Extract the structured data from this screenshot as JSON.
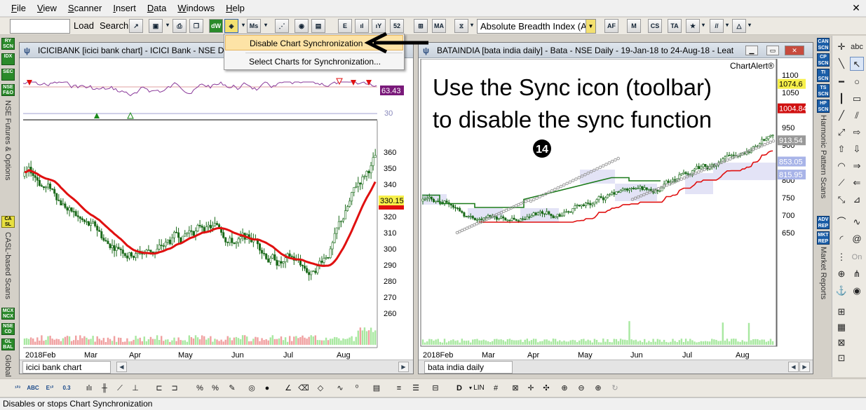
{
  "menu": [
    "File",
    "View",
    "Scanner",
    "Insert",
    "Data",
    "Windows",
    "Help"
  ],
  "menu_underline": [
    "F",
    "V",
    "S",
    "I",
    "D",
    "W",
    "H"
  ],
  "toolbar": {
    "load_label": "Load",
    "search_label": "Search",
    "indicator_combo": "Absolute Breadth Index (ABI",
    "icons": [
      "sync-icon",
      "save-icon",
      "print-icon",
      "dw-icon",
      "chart-sync-icon",
      "ms-icon",
      "grid-icon",
      "gauge-icon",
      "indicator-icon",
      "52w-icon",
      "ma-icon",
      "harmonic-icon",
      "autofib-icon",
      "mpvt-icon",
      "cswtam-icon",
      "tas-icon",
      "trend-icon",
      "pattern-icon"
    ]
  },
  "sync_menu": {
    "disable": "Disable Chart Synchronization",
    "select": "Select Charts for Synchronization..."
  },
  "left_sidebar": {
    "buttons": [
      "RY SCN",
      "IDX",
      "SEC",
      "NSE F&O",
      "CA SL",
      "MCX NCX",
      "NSE CD",
      "GL BAL"
    ],
    "labels": [
      "NSE Futures & Options",
      "CASL-based Scans",
      "Global I"
    ]
  },
  "chart_left": {
    "title": "ICICIBANK [icici bank chart] - ICICI Bank - NSE Dai",
    "tab": "icici bank chart",
    "indicator_value": "63.43",
    "indicator_low": "30",
    "price_labels": [
      "360",
      "350",
      "340",
      "330",
      "320",
      "310",
      "300",
      "290",
      "280",
      "270",
      "260"
    ],
    "last_price": "330.15",
    "months": [
      "2018Feb",
      "Mar",
      "Apr",
      "May",
      "Jun",
      "Jul",
      "Aug"
    ]
  },
  "chart_right": {
    "title": "BATAINDIA [bata india daily] - Bata - NSE Daily - 19-Jan-18 to 24-Aug-18 - Leat",
    "tab": "bata india daily",
    "watermark": "ChartAlert®",
    "annotation_line1": "Use the Sync icon (toolbar)",
    "annotation_line2": "to disable the sync function",
    "step_badge": "14",
    "price_labels": [
      "1100",
      "1050",
      "950",
      "900",
      "800",
      "750",
      "700",
      "650"
    ],
    "tag_last": "1074.6",
    "tag_stop": "1004.84",
    "tag_psar": "913.54",
    "tag_band_top": "853.05",
    "tag_band_bottom": "815.95",
    "months": [
      "2018Feb",
      "Mar",
      "Apr",
      "May",
      "Jun",
      "Jul",
      "Aug"
    ]
  },
  "right_sidebar": {
    "buttons": [
      "CAN SCN",
      "CP SCN",
      "TI SCN",
      "TS SCN",
      "HP SCN",
      "ADV REP",
      "MKT REP"
    ],
    "labels": [
      "Harmonic Pattern Scans",
      "Market Reports"
    ]
  },
  "drawing_tools": {
    "abc": "abc",
    "on": "On"
  },
  "bottom_toolbar": {
    "lin": "LIN",
    "d": "D"
  },
  "status": "Disables or stops Chart Synchronization"
}
